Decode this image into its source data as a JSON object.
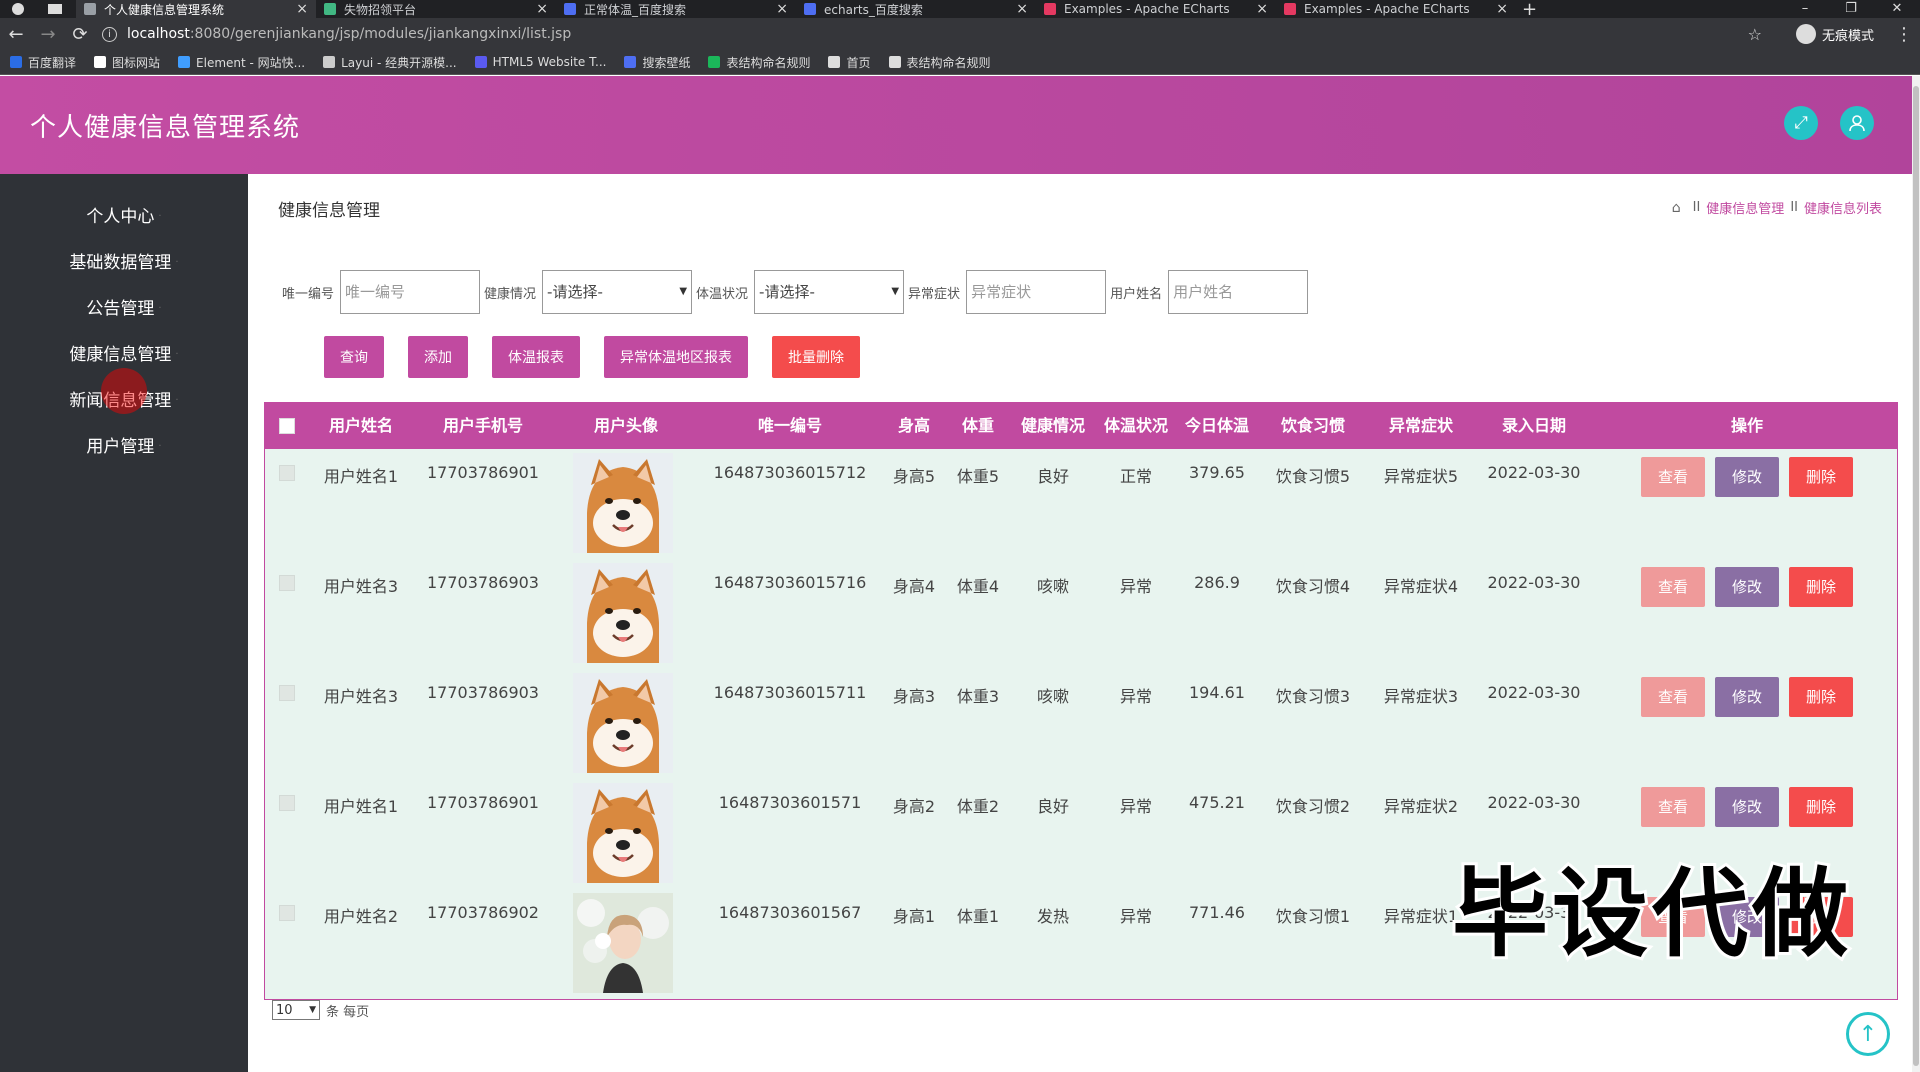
{
  "browser": {
    "tabs": [
      {
        "title": "个人健康信息管理系统",
        "active": true,
        "color": "#9aa0a6"
      },
      {
        "title": "失物招领平台",
        "active": false,
        "color": "#41b883"
      },
      {
        "title": "正常体温_百度搜索",
        "active": false,
        "color": "#4e6ef2"
      },
      {
        "title": "echarts_百度搜索",
        "active": false,
        "color": "#4e6ef2"
      },
      {
        "title": "Examples - Apache ECharts",
        "active": false,
        "color": "#e43961"
      },
      {
        "title": "Examples - Apache ECharts",
        "active": false,
        "color": "#e43961"
      }
    ],
    "url_host": "localhost",
    "url_path": ":8080/gerenjiankang/jsp/modules/jiankangxinxi/list.jsp",
    "incognito_label": "无痕模式",
    "bookmarks": [
      {
        "label": "百度翻译",
        "color": "#2b6de6"
      },
      {
        "label": "图标网站",
        "color": "#ffffff"
      },
      {
        "label": "Element - 网站快...",
        "color": "#409eff"
      },
      {
        "label": "Layui - 经典开源模...",
        "color": "#cccccc"
      },
      {
        "label": "HTML5 Website T...",
        "color": "#5a5af0"
      },
      {
        "label": "搜索壁纸",
        "color": "#4e6ef2"
      },
      {
        "label": "表结构命名规则",
        "color": "#1bb75a"
      },
      {
        "label": "首页",
        "color": "#dddddd"
      },
      {
        "label": "表结构命名规则",
        "color": "#dddddd"
      }
    ]
  },
  "header": {
    "title": "个人健康信息管理系统",
    "accent": "#c14aa0",
    "icon_color": "#25c3c7"
  },
  "sidebar": {
    "items": [
      {
        "label": "个人中心"
      },
      {
        "label": "基础数据管理"
      },
      {
        "label": "公告管理"
      },
      {
        "label": "健康信息管理"
      },
      {
        "label": "新闻信息管理"
      },
      {
        "label": "用户管理"
      }
    ]
  },
  "page": {
    "title": "健康信息管理",
    "breadcrumb": [
      "健康信息管理",
      "健康信息列表"
    ]
  },
  "filters": {
    "id_label": "唯一编号",
    "id_placeholder": "唯一编号",
    "health_label": "健康情况",
    "health_value": "-请选择-",
    "temp_label": "体温状况",
    "temp_value": "-请选择-",
    "symptom_label": "异常症状",
    "symptom_placeholder": "异常症状",
    "name_label": "用户姓名",
    "name_placeholder": "用户姓名"
  },
  "buttons": {
    "query": "查询",
    "add": "添加",
    "temp_report": "体温报表",
    "abnormal_report": "异常体温地区报表",
    "batch_delete": "批量删除"
  },
  "table": {
    "headers": [
      "用户姓名",
      "用户手机号",
      "用户头像",
      "唯一编号",
      "身高",
      "体重",
      "健康情况",
      "体温状况",
      "今日体温",
      "饮食习惯",
      "异常症状",
      "录入日期",
      "操作"
    ],
    "actions": {
      "view": "查看",
      "edit": "修改",
      "delete": "删除"
    },
    "rows": [
      {
        "name": "用户姓名1",
        "phone": "17703786901",
        "avatar": "shiba-dog",
        "id": "164873036015712",
        "height": "身高5",
        "weight": "体重5",
        "health": "良好",
        "temp_status": "正常",
        "temp": "379.65",
        "diet": "饮食习惯5",
        "symptom": "异常症状5",
        "date": "2022-03-30"
      },
      {
        "name": "用户姓名3",
        "phone": "17703786903",
        "avatar": "shiba-dog",
        "id": "164873036015716",
        "height": "身高4",
        "weight": "体重4",
        "health": "咳嗽",
        "temp_status": "异常",
        "temp": "286.9",
        "diet": "饮食习惯4",
        "symptom": "异常症状4",
        "date": "2022-03-30"
      },
      {
        "name": "用户姓名3",
        "phone": "17703786903",
        "avatar": "shiba-dog",
        "id": "164873036015711",
        "height": "身高3",
        "weight": "体重3",
        "health": "咳嗽",
        "temp_status": "异常",
        "temp": "194.61",
        "diet": "饮食习惯3",
        "symptom": "异常症状3",
        "date": "2022-03-30"
      },
      {
        "name": "用户姓名1",
        "phone": "17703786901",
        "avatar": "shiba-dog",
        "id": "16487303601571",
        "height": "身高2",
        "weight": "体重2",
        "health": "良好",
        "temp_status": "异常",
        "temp": "475.21",
        "diet": "饮食习惯2",
        "symptom": "异常症状2",
        "date": "2022-03-30"
      },
      {
        "name": "用户姓名2",
        "phone": "17703786902",
        "avatar": "person-photo",
        "id": "16487303601567",
        "height": "身高1",
        "weight": "体重1",
        "health": "发热",
        "temp_status": "异常",
        "temp": "771.46",
        "diet": "饮食习惯1",
        "symptom": "异常症状1",
        "date": "2022-03-30"
      }
    ]
  },
  "pager": {
    "page_size": "10",
    "suffix": "条 每页"
  },
  "watermark": "毕设代做"
}
